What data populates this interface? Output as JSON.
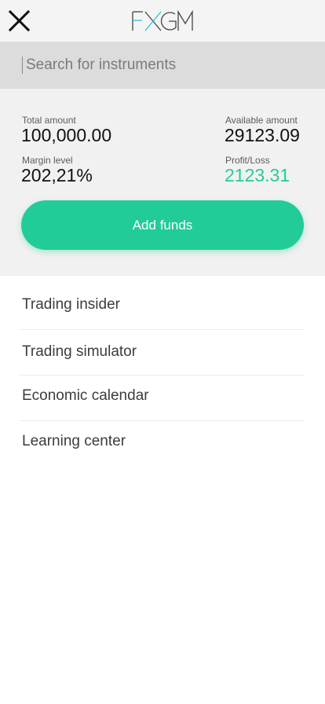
{
  "header": {
    "close_icon": "close-icon",
    "logo_text": "FXGM",
    "logo_accent_color": "#22c4e0"
  },
  "search": {
    "placeholder": "Search for instruments",
    "value": ""
  },
  "account": {
    "total_amount_label": "Total amount",
    "total_amount_value": "100,000.00",
    "available_amount_label": "Available amount",
    "available_amount_value": "29123.09",
    "margin_level_label": "Margin level",
    "margin_level_value": "202,21%",
    "profit_loss_label": "Profit/Loss",
    "profit_loss_value": "2123.31",
    "add_funds_label": "Add funds"
  },
  "menu": {
    "items": [
      {
        "label": "Trading insider"
      },
      {
        "label": "Trading simulator"
      },
      {
        "label": "Economic calendar"
      },
      {
        "label": "Learning center"
      }
    ]
  },
  "colors": {
    "accent_green": "#22cc99",
    "header_bg": "#f4f4f4",
    "search_bg": "#dcdcdc",
    "panel_bg": "#f1f1f1"
  }
}
